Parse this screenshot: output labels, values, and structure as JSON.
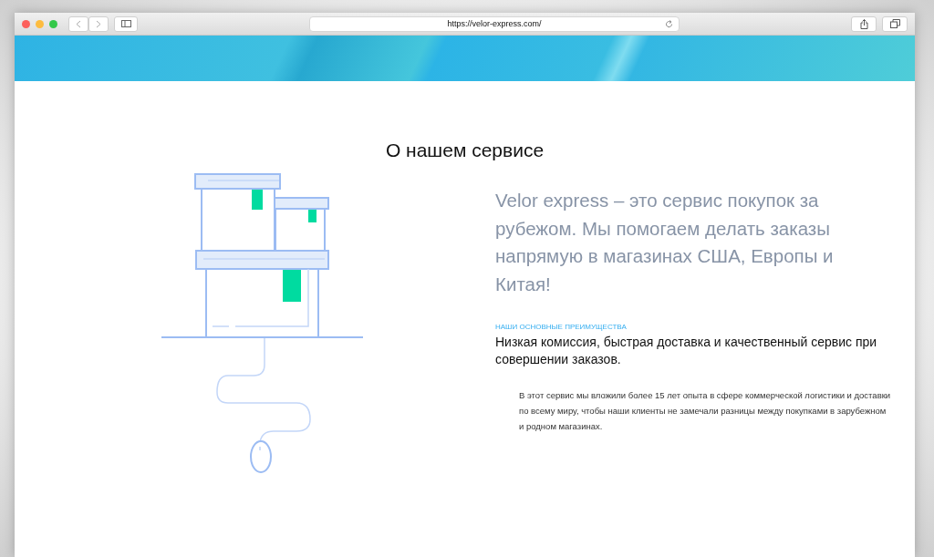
{
  "browser": {
    "url": "https://velor-express.com/"
  },
  "section": {
    "title": "О нашем сервисе",
    "lead": "Velor express – это сервис покупок за рубежом. Мы помогаем делать заказы напрямую в магазинах США, Европы и Китая!",
    "subheading": "НАШИ ОСНОВНЫЕ ПРЕИМУЩЕСТВА",
    "highlight": "Низкая комиссия, быстрая доставка и качественный сервис при совершении заказов.",
    "body": "В этот сервис мы вложили более 15 лет опыта в сфере коммерческой логистики и доставки по всему миру, чтобы наши клиенты не замечали разницы между покупками в зарубежном и родном магазинах."
  }
}
